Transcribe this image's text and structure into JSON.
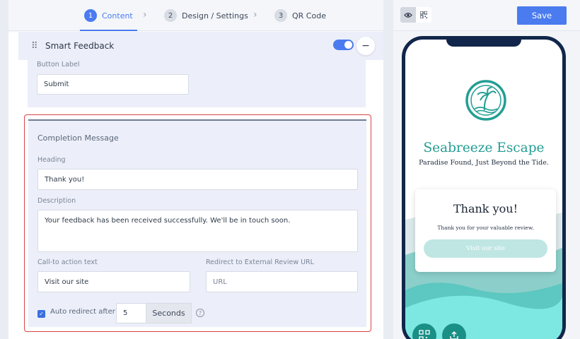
{
  "steps": [
    {
      "num": "1",
      "label": "Content"
    },
    {
      "num": "2",
      "label": "Design / Settings"
    },
    {
      "num": "3",
      "label": "QR Code"
    }
  ],
  "smart_feedback": {
    "title": "Smart Feedback",
    "toggle_on": true,
    "button_label_label": "Button Label",
    "button_label_value": "Submit"
  },
  "completion": {
    "section_title": "Completion Message",
    "heading_label": "Heading",
    "heading_value": "Thank you!",
    "description_label": "Description",
    "description_value": "Your feedback has been received successfully. We'll be in touch soon.",
    "cta_label": "Call-to action text",
    "cta_value": "Visit our site",
    "redirect_label": "Redirect to External Review URL",
    "redirect_placeholder": "URL",
    "auto_redirect_label": "Auto redirect after",
    "auto_redirect_checked": true,
    "seconds_value": "5",
    "seconds_unit": "Seconds"
  },
  "toolbar": {
    "save_label": "Save"
  },
  "preview": {
    "brand_name": "Seabreeze Escape",
    "tagline": "Paradise Found, Just Beyond the Tide.",
    "card_heading": "Thank you!",
    "card_description": "Thank you for your valuable review.",
    "card_button": "Visit our site"
  },
  "colors": {
    "accent": "#4a7bef",
    "highlight_border": "#d64545",
    "brand_teal": "#239e93",
    "phone_frame": "#11264a"
  },
  "icons": [
    "drag-handle-icon",
    "chevron-right-icon",
    "minus-icon",
    "checkbox-check-icon",
    "help-icon",
    "eye-icon",
    "qr-icon",
    "resort-logo-icon",
    "qr-code-fab-icon",
    "share-icon"
  ]
}
